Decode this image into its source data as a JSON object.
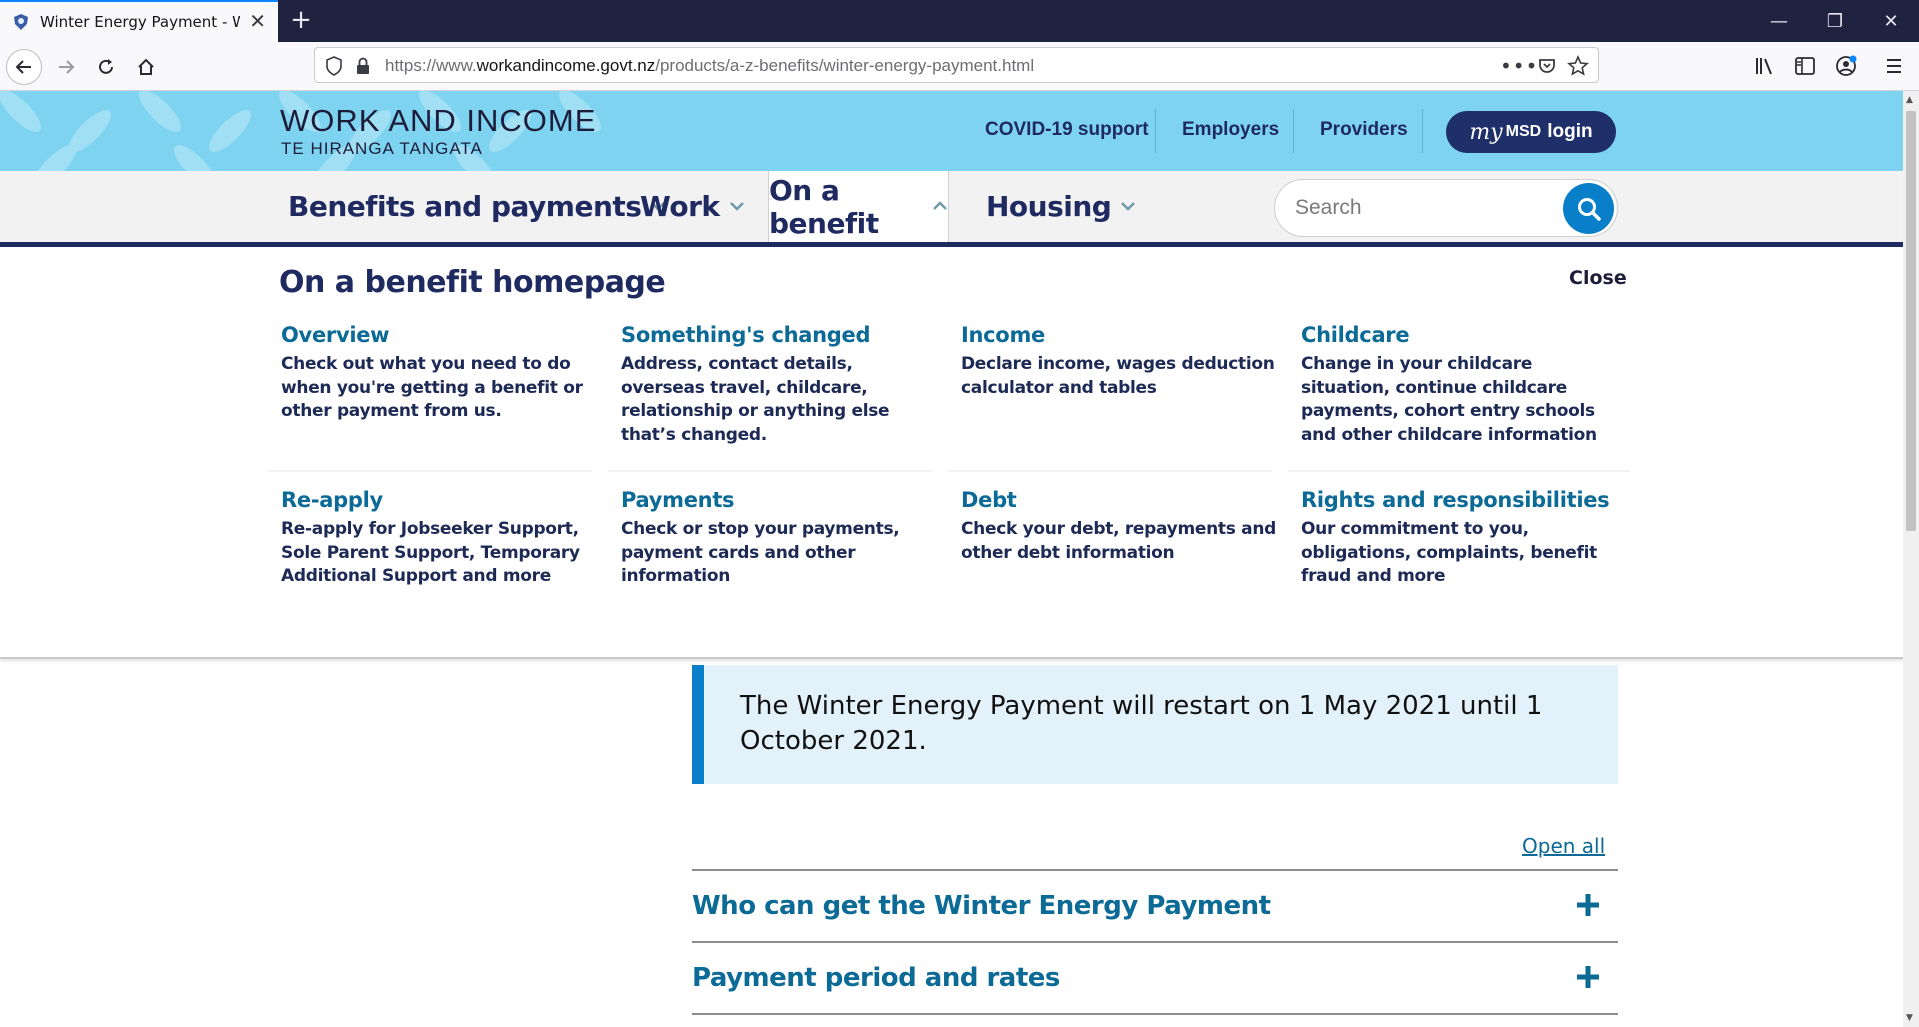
{
  "browser": {
    "tab_title": "Winter Energy Payment - Work",
    "url_prefix": "https://www.",
    "url_domain": "workandincome.govt.nz",
    "url_path": "/products/a-z-benefits/winter-energy-payment.html"
  },
  "header": {
    "logo_line1": "WORK AND INCOME",
    "logo_line2": "TE HIRANGA TANGATA",
    "links": [
      "COVID-19 support",
      "Employers",
      "Providers"
    ],
    "login_my": "my",
    "login_msd": "MSD",
    "login_label": "login"
  },
  "nav": {
    "items": [
      "Benefits and payments",
      "Work",
      "On a benefit",
      "Housing"
    ],
    "active": "On a benefit",
    "search_placeholder": "Search"
  },
  "mega_menu": {
    "title": "On a benefit homepage",
    "close_label": "Close",
    "cards": [
      {
        "title": "Overview",
        "desc": "Check out what you need to do when you're getting a benefit or other payment from us."
      },
      {
        "title": "Something's changed",
        "desc": "Address, contact details, overseas travel, childcare, relationship or anything else that’s changed."
      },
      {
        "title": "Income",
        "desc": "Declare income, wages deduction calculator and tables"
      },
      {
        "title": "Childcare",
        "desc": "Change in your childcare situation, continue childcare payments, cohort entry schools and other childcare information"
      },
      {
        "title": "Re-apply",
        "desc": "Re-apply for Jobseeker Support, Sole Parent Support, Temporary Additional Support and more"
      },
      {
        "title": "Payments",
        "desc": "Check or stop your payments, payment cards and other information"
      },
      {
        "title": "Debt",
        "desc": "Check your debt, repayments and other debt information"
      },
      {
        "title": "Rights and responsibilities",
        "desc": "Our commitment to you,  obligations, complaints, benefit fraud and more"
      }
    ]
  },
  "content": {
    "notice": "The Winter Energy Payment will restart on 1 May 2021 until 1 October 2021.",
    "open_all": "Open all",
    "accordions": [
      "Who can get the Winter Energy Payment",
      "Payment period and rates"
    ]
  },
  "colors": {
    "header_bg": "#7dd3f0",
    "navy": "#1f2a60",
    "link_blue": "#0b6a96",
    "accent_blue": "#0a7fc9"
  }
}
